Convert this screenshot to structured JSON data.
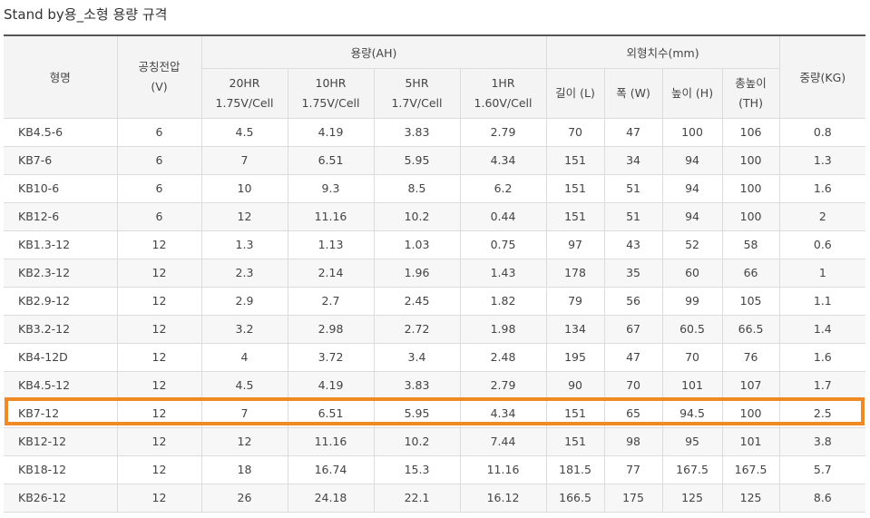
{
  "title": "Stand by용_소형 용량 규격",
  "header": {
    "model": "형명",
    "voltage_line1": "공칭전압",
    "voltage_line2": "(V)",
    "capacity_group": "용량(AH)",
    "dimensions_group": "외형치수(mm)",
    "weight": "중량(KG)",
    "capacity_cols": [
      {
        "rate": "20HR",
        "cell": "1.75V/Cell"
      },
      {
        "rate": "10HR",
        "cell": "1.75V/Cell"
      },
      {
        "rate": "5HR",
        "cell": "1.7V/Cell"
      },
      {
        "rate": "1HR",
        "cell": "1.60V/Cell"
      }
    ],
    "dim_cols": [
      {
        "line1": "길이 (L)",
        "line2": ""
      },
      {
        "line1": "폭 (W)",
        "line2": ""
      },
      {
        "line1": "높이 (H)",
        "line2": ""
      },
      {
        "line1": "총높이",
        "line2": "(TH)"
      }
    ]
  },
  "rows": [
    [
      "KB4.5-6",
      "6",
      "4.5",
      "4.19",
      "3.83",
      "2.79",
      "70",
      "47",
      "100",
      "106",
      "0.8"
    ],
    [
      "KB7-6",
      "6",
      "7",
      "6.51",
      "5.95",
      "4.34",
      "151",
      "34",
      "94",
      "100",
      "1.3"
    ],
    [
      "KB10-6",
      "6",
      "10",
      "9.3",
      "8.5",
      "6.2",
      "151",
      "51",
      "94",
      "100",
      "1.6"
    ],
    [
      "KB12-6",
      "6",
      "12",
      "11.16",
      "10.2",
      "0.44",
      "151",
      "51",
      "94",
      "100",
      "2"
    ],
    [
      "KB1.3-12",
      "12",
      "1.3",
      "1.13",
      "1.03",
      "0.75",
      "97",
      "43",
      "52",
      "58",
      "0.6"
    ],
    [
      "KB2.3-12",
      "12",
      "2.3",
      "2.14",
      "1.96",
      "1.43",
      "178",
      "35",
      "60",
      "66",
      "1"
    ],
    [
      "KB2.9-12",
      "12",
      "2.9",
      "2.7",
      "2.45",
      "1.82",
      "79",
      "56",
      "99",
      "105",
      "1.1"
    ],
    [
      "KB3.2-12",
      "12",
      "3.2",
      "2.98",
      "2.72",
      "1.98",
      "134",
      "67",
      "60.5",
      "66.5",
      "1.4"
    ],
    [
      "KB4-12D",
      "12",
      "4",
      "3.72",
      "3.4",
      "2.48",
      "195",
      "47",
      "70",
      "76",
      "1.6"
    ],
    [
      "KB4.5-12",
      "12",
      "4.5",
      "4.19",
      "3.83",
      "2.79",
      "90",
      "70",
      "101",
      "107",
      "1.7"
    ],
    [
      "KB7-12",
      "12",
      "7",
      "6.51",
      "5.95",
      "4.34",
      "151",
      "65",
      "94.5",
      "100",
      "2.5"
    ],
    [
      "KB12-12",
      "12",
      "12",
      "11.16",
      "10.2",
      "7.44",
      "151",
      "98",
      "95",
      "101",
      "3.8"
    ],
    [
      "KB18-12",
      "12",
      "18",
      "16.74",
      "15.3",
      "11.16",
      "181.5",
      "77",
      "167.5",
      "167.5",
      "5.7"
    ],
    [
      "KB26-12",
      "12",
      "26",
      "24.18",
      "22.1",
      "16.12",
      "166.5",
      "175",
      "125",
      "125",
      "8.6"
    ]
  ],
  "highlight_color": "#f08a24"
}
